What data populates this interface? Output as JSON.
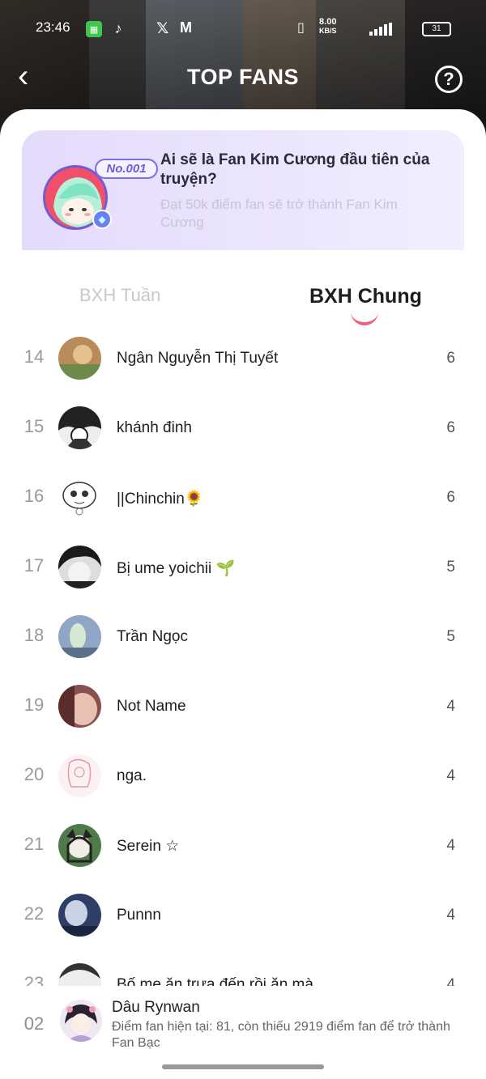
{
  "status_bar": {
    "time": "23:46",
    "speed_value": "8.00",
    "speed_unit": "KB/S",
    "battery": "31"
  },
  "header": {
    "title": "TOP FANS",
    "help_glyph": "?",
    "back_glyph": "‹"
  },
  "banner": {
    "rank_tag": "No.001",
    "title": "Ai sẽ là Fan Kim Cương đầu tiên của truyện?",
    "subtitle": "Đạt 50k điểm fan sẽ trở thành Fan Kim Cương"
  },
  "tabs": {
    "weekly": "BXH Tuần",
    "overall": "BXH Chung",
    "active": "overall"
  },
  "leaderboard": [
    {
      "rank": "14",
      "name": "Ngân Nguyễn Thị Tuyết",
      "score": "6"
    },
    {
      "rank": "15",
      "name": "khánh đinh",
      "score": "6"
    },
    {
      "rank": "16",
      "name": "||Chinchin🌻",
      "score": "6"
    },
    {
      "rank": "17",
      "name": "Bị ume yoichii 🌱",
      "score": "5"
    },
    {
      "rank": "18",
      "name": "Trần Ngọc",
      "score": "5"
    },
    {
      "rank": "19",
      "name": "Not Name",
      "score": "4"
    },
    {
      "rank": "20",
      "name": "nga.",
      "score": "4"
    },
    {
      "rank": "21",
      "name": "Serein ☆",
      "score": "4"
    },
    {
      "rank": "22",
      "name": "Punnn",
      "score": "4"
    },
    {
      "rank": "23",
      "name": "Bố mẹ ăn trưa đến rồi ăn mà...",
      "score": "4"
    }
  ],
  "me": {
    "rank": "02",
    "name": "Dâu Rynwan",
    "desc": "Điểm fan hiện tại: 81, còn thiếu 2919 điểm fan để trở thành Fan Bạc"
  },
  "colors": {
    "accent": "#f0607c",
    "banner_bg": "#e8e0fc",
    "badge_purple": "#6f5bd6"
  }
}
